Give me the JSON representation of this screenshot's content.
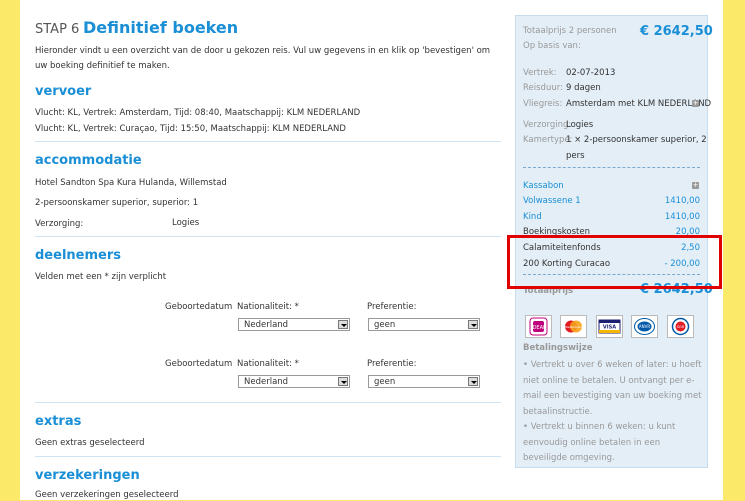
{
  "header": {
    "step": "STAP 6",
    "title": "Definitief boeken"
  },
  "intro": "Hieronder vindt u een overzicht van de door u gekozen reis. Vul uw gegevens in en klik op 'bevestigen' om uw boeking definitief te maken.",
  "vervoer": {
    "heading": "vervoer",
    "lines": [
      "Vlucht: KL, Vertrek: Amsterdam, Tijd: 08:40, Maatschappij: KLM NEDERLAND",
      "Vlucht: KL, Vertrek: Curaçao, Tijd: 15:50, Maatschappij: KLM NEDERLAND"
    ]
  },
  "accommodatie": {
    "heading": "accommodatie",
    "hotel": "Hotel Sandton Spa Kura Hulanda, Willemstad",
    "room": "2-persoonskamer superior, superior: 1",
    "verzorging_label": "Verzorging:",
    "verzorging_value": "Logies"
  },
  "deelnemers": {
    "heading": "deelnemers",
    "note": "Velden met een * zijn verplicht",
    "rows": [
      {
        "birth_label": "Geboortedatum",
        "nat_label": "Nationaliteit: *",
        "nat_value": "Nederland",
        "pref_label": "Preferentie:",
        "pref_value": "geen"
      },
      {
        "birth_label": "Geboortedatum",
        "nat_label": "Nationaliteit: *",
        "nat_value": "Nederland",
        "pref_label": "Preferentie:",
        "pref_value": "geen"
      }
    ]
  },
  "extras": {
    "heading": "extras",
    "text": "Geen extras geselecteerd"
  },
  "verzekeringen": {
    "heading": "verzekeringen",
    "text": "Geen verzekeringen geselecteerd"
  },
  "sidebar": {
    "total_label_1": "Totaalprijs 2 personen",
    "total_label_2": "Op basis van:",
    "total_value": "€ 2642,50",
    "details": [
      {
        "label": "Vertrek:",
        "value": "02-07-2013"
      },
      {
        "label": "Reisduur:",
        "value": "9 dagen"
      },
      {
        "label": "Vliegreis:",
        "value": "Amsterdam met KLM NEDERLAND"
      },
      {
        "label": "Verzorging:",
        "value": "Logies"
      },
      {
        "label": "Kamertype:",
        "value": "1 × 2-persoonskamer superior, 2"
      },
      {
        "label": "",
        "value": "pers"
      }
    ],
    "kassabon_label": "Kassabon",
    "lines": [
      {
        "label": "Volwassene 1",
        "value": "1410,00"
      },
      {
        "label": "Kind",
        "value": "1410,00"
      },
      {
        "label": "Boekingskosten",
        "value": "20,00"
      },
      {
        "label": "Calamiteitenfonds",
        "value": "2,50"
      },
      {
        "label": "200 Korting Curacao",
        "value": "- 200,00"
      }
    ],
    "total2_label": "Totaalprijs",
    "total2_value": "€ 2642,50",
    "payment_icons": [
      "ideal-icon",
      "mastercard-icon",
      "visa-icon",
      "anwb-icon",
      "sgr-icon"
    ],
    "payment_icon_texts": [
      "iDEAL",
      "MasterCard",
      "VISA",
      "ANVR",
      "SGR"
    ],
    "betalingswijze_label": "Betalingswijze",
    "bullets": [
      "• Vertrekt u over 6 weken of later: u hoeft niet online te betalen. U ontvangt per e-mail een bevestiging van uw boeking met betaalinstructie.",
      "• Vertrekt u binnen 6 weken: u kunt eenvoudig online betalen in een beveiligde omgeving."
    ]
  },
  "colors": {
    "accent": "#1a8fd6",
    "page_bg": "#fbe96a",
    "sidebar_bg": "#e3eef7",
    "highlight": "#e00000"
  }
}
